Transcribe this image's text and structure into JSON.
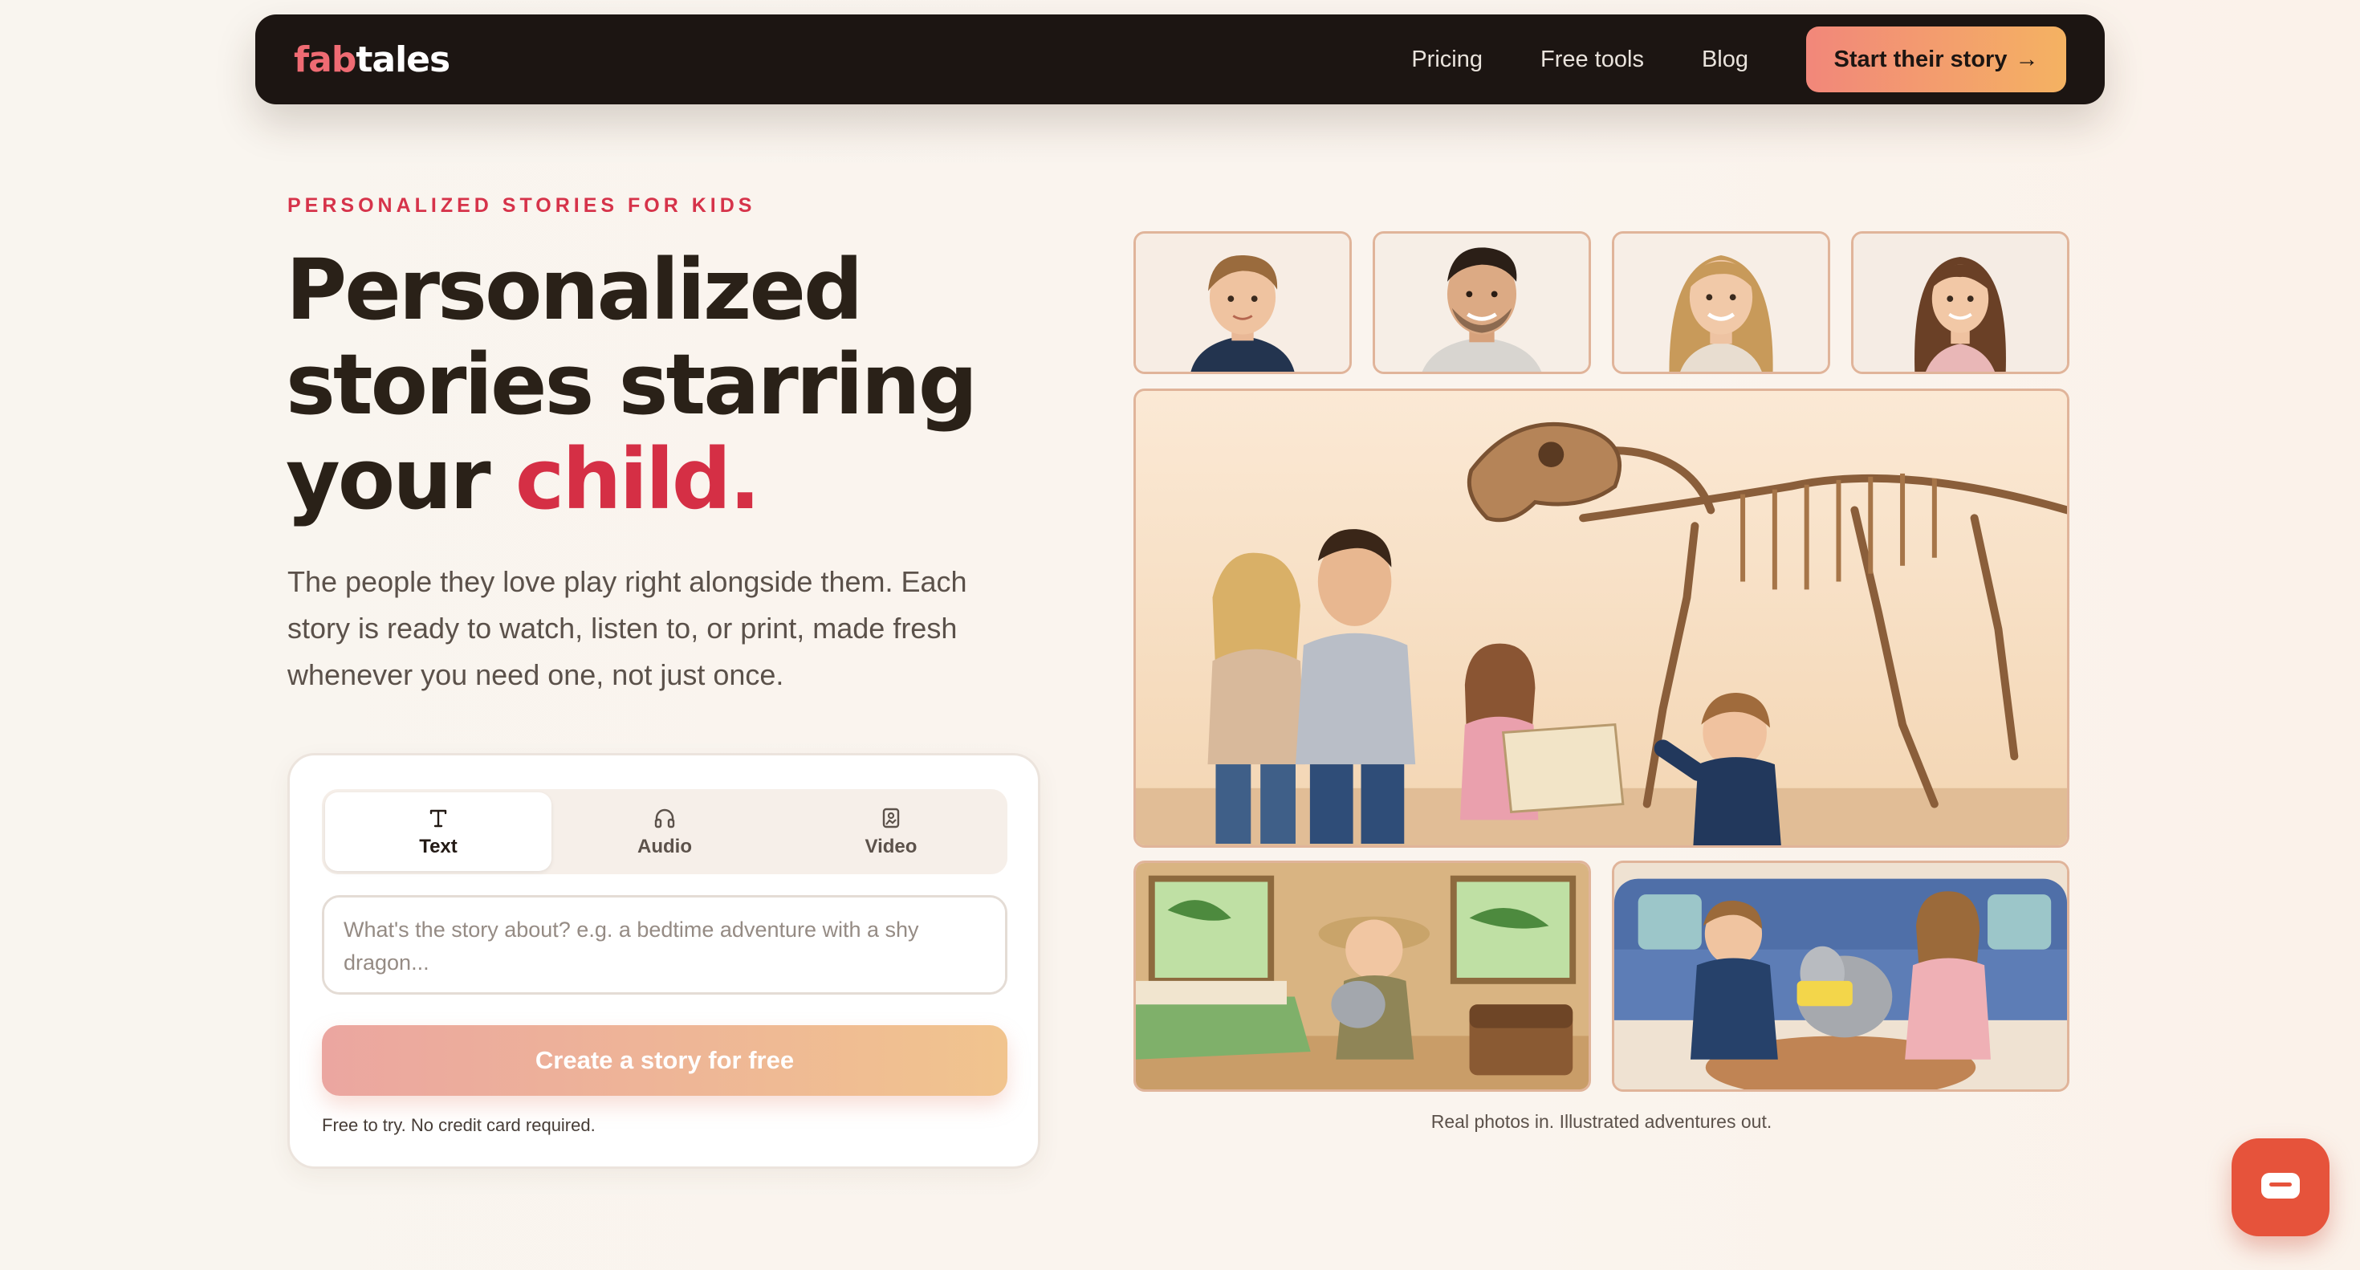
{
  "nav": {
    "logo_part1": "fab",
    "logo_part2": "tales",
    "links": [
      "Pricing",
      "Free tools",
      "Blog"
    ],
    "cta_label": "Start their story",
    "cta_arrow": "→"
  },
  "hero": {
    "eyebrow": "PERSONALIZED STORIES FOR KIDS",
    "headline_line1": "Personalized",
    "headline_line2": "stories starring",
    "headline_line3_prefix": "your ",
    "headline_accent": "child.",
    "subtext": "The people they love play right alongside them. Each story is ready to watch, listen to, or print, made fresh whenever you need one, not just once."
  },
  "composer": {
    "tabs": [
      {
        "label": "Text",
        "icon": "text-icon",
        "active": true
      },
      {
        "label": "Audio",
        "icon": "headphones-icon",
        "active": false
      },
      {
        "label": "Video",
        "icon": "video-frame-icon",
        "active": false
      }
    ],
    "input_value": "",
    "input_placeholder": "What's the story about? e.g. a bedtime adventure with a shy dragon...",
    "submit_label": "Create a story for free",
    "note": "Free to try. No credit card required."
  },
  "gallery": {
    "caption": "Real photos in. Illustrated adventures out."
  },
  "colors": {
    "accent": "#d52f45",
    "nav_bg": "#1c1512",
    "cta_gradient_start": "#f2877a",
    "cta_gradient_end": "#f4b262",
    "chat": "#e6533b"
  },
  "chat_widget": {
    "icon": "chat-bubble-icon"
  }
}
